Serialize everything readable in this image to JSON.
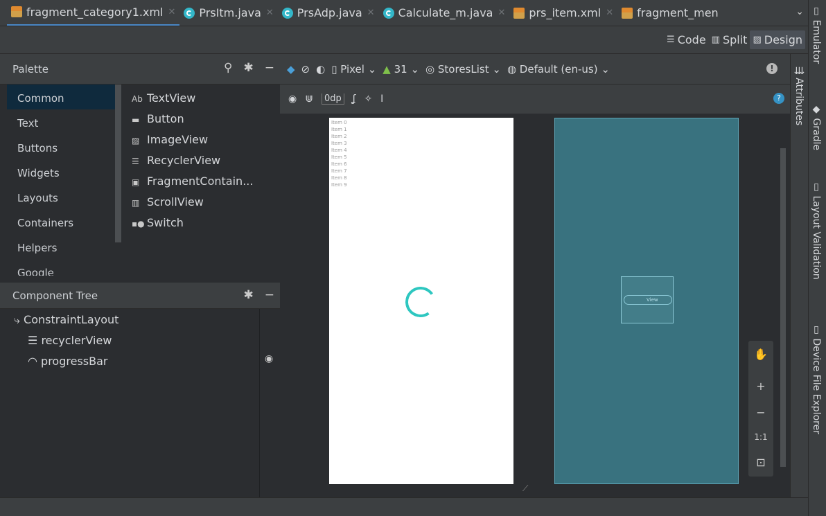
{
  "tabs": [
    {
      "label": "fragment_category1.xml",
      "icon": "xml-file-icon",
      "active": true
    },
    {
      "label": "PrsItm.java",
      "icon": "java-class-icon"
    },
    {
      "label": "PrsAdp.java",
      "icon": "java-class-icon"
    },
    {
      "label": "Calculate_m.java",
      "icon": "java-class-icon"
    },
    {
      "label": "prs_item.xml",
      "icon": "xml-file-icon"
    },
    {
      "label": "fragment_men",
      "icon": "xml-file-icon"
    }
  ],
  "view_modes": {
    "code": "Code",
    "split": "Split",
    "design": "Design",
    "active": "Design"
  },
  "right_tools": [
    "Emulator",
    "Gradle",
    "Layout Validation",
    "Device File Explorer"
  ],
  "palette": {
    "title": "Palette",
    "categories": [
      "Common",
      "Text",
      "Buttons",
      "Widgets",
      "Layouts",
      "Containers",
      "Helpers",
      "Google"
    ],
    "selected_category": "Common",
    "widgets": [
      {
        "label": "TextView",
        "icon": "textview-icon",
        "glyph": "Ab"
      },
      {
        "label": "Button",
        "icon": "button-icon",
        "glyph": "▬"
      },
      {
        "label": "ImageView",
        "icon": "imageview-icon",
        "glyph": "▨"
      },
      {
        "label": "RecyclerView",
        "icon": "recyclerview-icon",
        "glyph": "☰"
      },
      {
        "label": "FragmentContain...",
        "icon": "fragment-container-icon",
        "glyph": "▣"
      },
      {
        "label": "ScrollView",
        "icon": "scrollview-icon",
        "glyph": "▥"
      },
      {
        "label": "Switch",
        "icon": "switch-icon",
        "glyph": "▪●"
      }
    ]
  },
  "component_tree": {
    "title": "Component Tree",
    "items": [
      {
        "label": "ConstraintLayout",
        "icon": "constraint-layout-icon"
      },
      {
        "label": "recyclerView",
        "icon": "recyclerview-icon"
      },
      {
        "label": "progressBar",
        "icon": "progressbar-icon"
      }
    ]
  },
  "toolbar": {
    "device": "Pixel",
    "api_level": "31",
    "theme": "StoresList",
    "locale": "Default (en-us)",
    "margin": "0dp",
    "attributes_label": "Attributes"
  },
  "preview": {
    "items": [
      "Item 0",
      "Item 1",
      "Item 2",
      "Item 3",
      "Item 4",
      "Item 5",
      "Item 6",
      "Item 7",
      "Item 8",
      "Item 9"
    ],
    "blueprint_label": "View"
  },
  "zoom": {
    "plus": "+",
    "minus": "−",
    "actual": "1:1"
  },
  "colors": {
    "accent": "#4a88c7",
    "blueprint": "#39727f",
    "spinner": "#2ec7c0"
  }
}
